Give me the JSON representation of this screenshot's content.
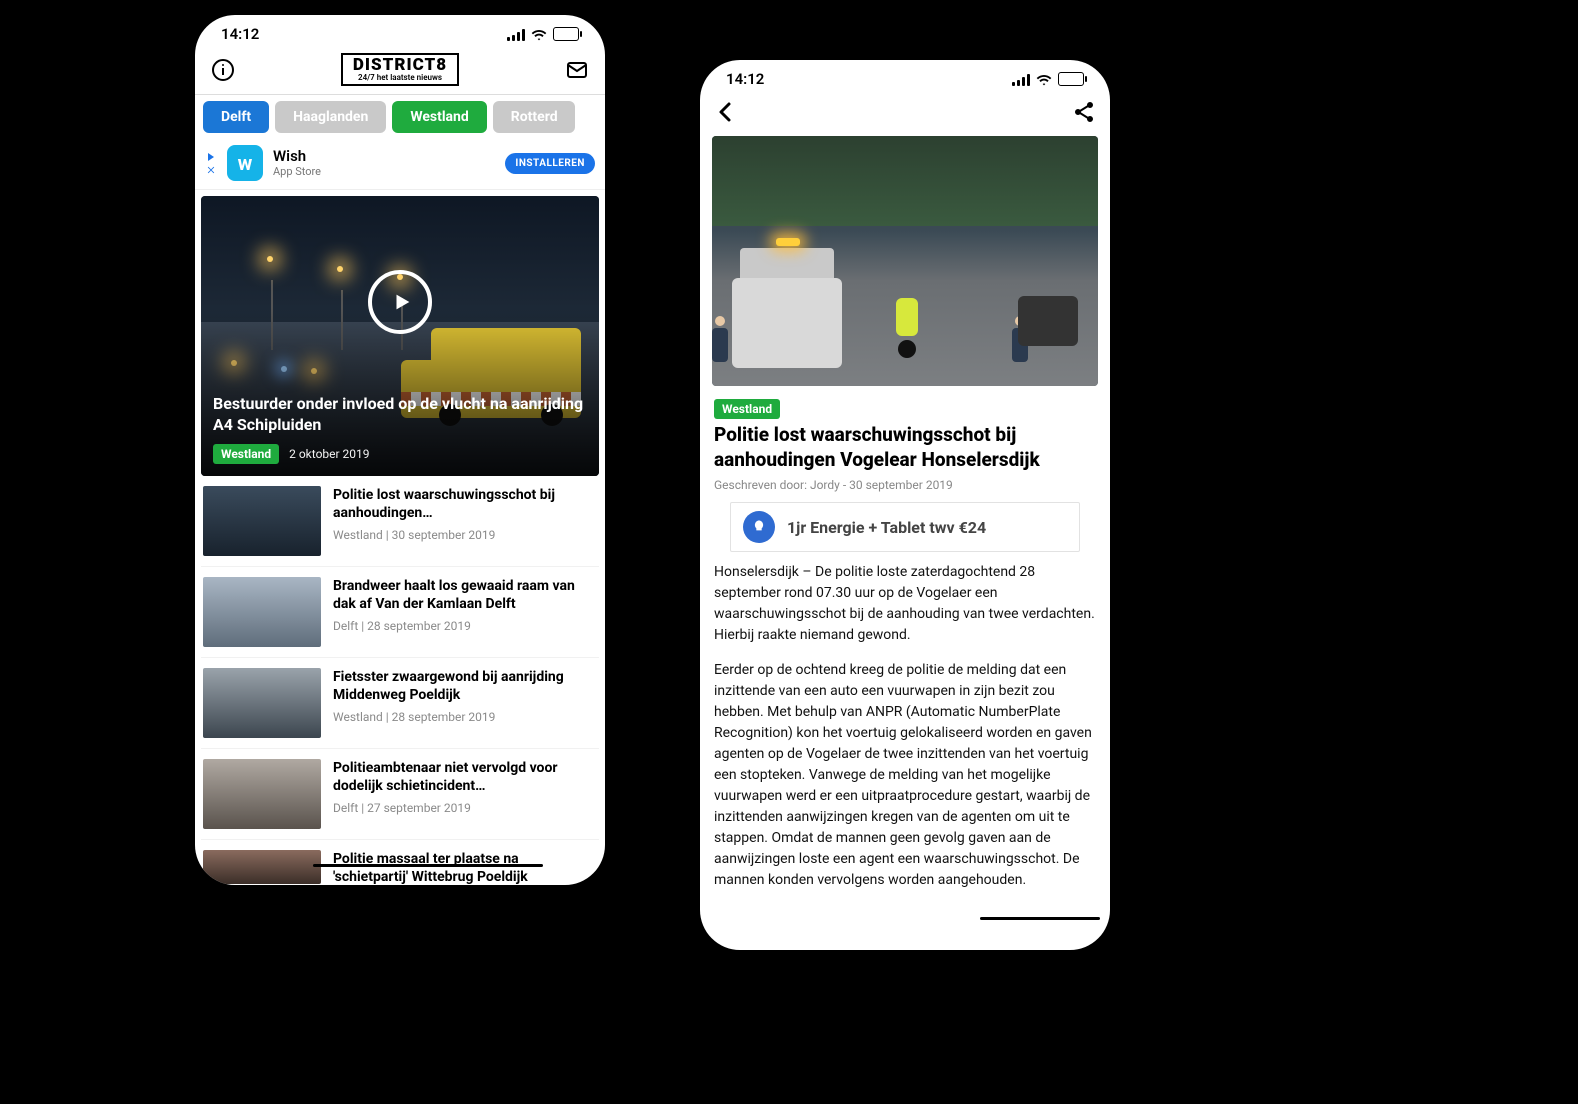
{
  "status": {
    "time": "14:12"
  },
  "header": {
    "logo_title": "DISTRICT8",
    "logo_subtitle": "24/7 het laatste nieuws"
  },
  "tabs": [
    {
      "label": "Delft",
      "style": "blue"
    },
    {
      "label": "Haaglanden",
      "style": "grey"
    },
    {
      "label": "Westland",
      "style": "green"
    },
    {
      "label": "Rotterd",
      "style": "grey"
    }
  ],
  "ad_top": {
    "glyph": "w",
    "title": "Wish",
    "subtitle": "App Store",
    "cta": "INSTALLEREN"
  },
  "hero": {
    "title": "Bestuurder onder invloed op de vlucht na aanrijding A4 Schipluiden",
    "badge": "Westland",
    "date": "2 oktober 2019"
  },
  "list": [
    {
      "title": "Politie lost waarschuwingsschot bij aanhoudingen…",
      "meta": "Westland | 30 september 2019"
    },
    {
      "title": "Brandweer haalt los gewaaid raam van dak af Van der Kamlaan Delft",
      "meta": "Delft | 28 september 2019"
    },
    {
      "title": "Fietsster zwaargewond bij aanrijding Middenweg Poeldijk",
      "meta": "Westland | 28 september 2019"
    },
    {
      "title": "Politieambtenaar niet vervolgd voor dodelijk schietincident…",
      "meta": "Delft | 27 september 2019"
    },
    {
      "title": "Politie massaal ter plaatse na 'schietpartij' Wittebrug Poeldijk",
      "meta": ""
    }
  ],
  "detail": {
    "badge": "Westland",
    "title": "Politie lost waarschuwingsschot bij aanhoudingen Vogelear Honselersdijk",
    "byline": "Geschreven door: Jordy - 30 september 2019",
    "ad_title": "1jr Energie + Tablet twv €24",
    "body": [
      "Honselersdijk – De politie loste zaterdagochtend 28 september rond 07.30 uur op de Vogelaer een waarschuwingsschot bij de aanhouding van twee verdachten. Hierbij raakte niemand gewond.",
      "Eerder op de ochtend kreeg de politie de melding dat een inzittende van een auto een vuurwapen in zijn bezit zou hebben. Met behulp van ANPR (Automatic NumberPlate Recognition) kon het voertuig gelokaliseerd worden en gaven agenten op de Vogelaer de twee inzittenden van het voertuig een stopteken. Vanwege de melding van het mogelijke vuurwapen werd er een uitpraatprocedure gestart, waarbij de inzittenden aanwijzingen kregen van de agenten om uit te stappen. Omdat de mannen geen gevolg gaven aan de aanwijzingen loste een agent een waarschuwingsschot. De mannen konden vervolgens worden aangehouden."
    ]
  }
}
